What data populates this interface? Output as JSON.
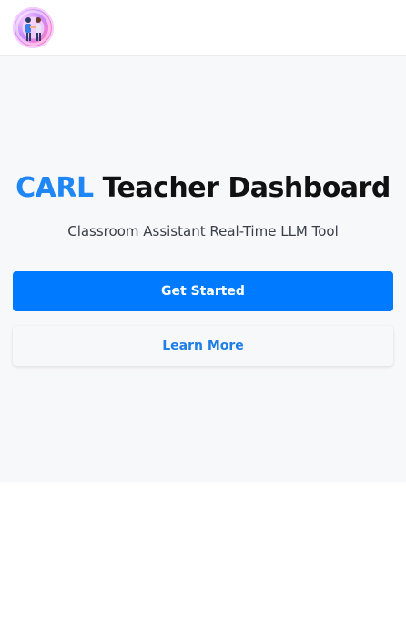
{
  "header": {
    "logo_icon": "people-handshake-icon"
  },
  "hero": {
    "title_brand": "CARL",
    "title_rest": "Teacher Dashboard",
    "subtitle": "Classroom Assistant Real-Time LLM Tool",
    "primary_button": "Get Started",
    "secondary_button": "Learn More"
  },
  "colors": {
    "brand": "#1f86f5",
    "primary_button": "#007bff",
    "hero_background": "#f7f8fa"
  }
}
